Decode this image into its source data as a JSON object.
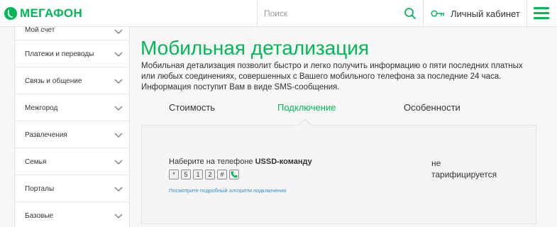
{
  "header": {
    "logo_text": "МЕГАФОН",
    "search_placeholder": "Поиск",
    "cabinet_label": "Личный кабинет"
  },
  "sidebar": {
    "items": [
      {
        "label": "Мой счет"
      },
      {
        "label": "Платежи и переводы"
      },
      {
        "label": "Связь и общение"
      },
      {
        "label": "Межгород"
      },
      {
        "label": "Развлечения"
      },
      {
        "label": "Семья"
      },
      {
        "label": "Порталы"
      },
      {
        "label": "Базовые"
      }
    ]
  },
  "main": {
    "title": "Мобильная детализация",
    "description": "Мобильная детализация позволит быстро и легко получить информацию о пяти последних платных или любых соединениях, совершенных с Вашего мобильного телефона за последние 24 часа. Информация поступит Вам в виде SMS-сообщения.",
    "tabs": [
      {
        "label": "Стоимость"
      },
      {
        "label": "Подключение"
      },
      {
        "label": "Особенности"
      }
    ],
    "active_tab": "Подключение",
    "panel": {
      "ussd_prefix": "Наберите на телефоне ",
      "ussd_bold": "USSD-команду",
      "keys": [
        "*",
        "5",
        "1",
        "2",
        "#"
      ],
      "algorithm_link": "Посмотрите подробный алгоритм подключения",
      "cost_line1": "не",
      "cost_line2": "тарифицируется"
    }
  },
  "colors": {
    "brand_green": "#00b956",
    "link_blue": "#2a8ed8"
  }
}
